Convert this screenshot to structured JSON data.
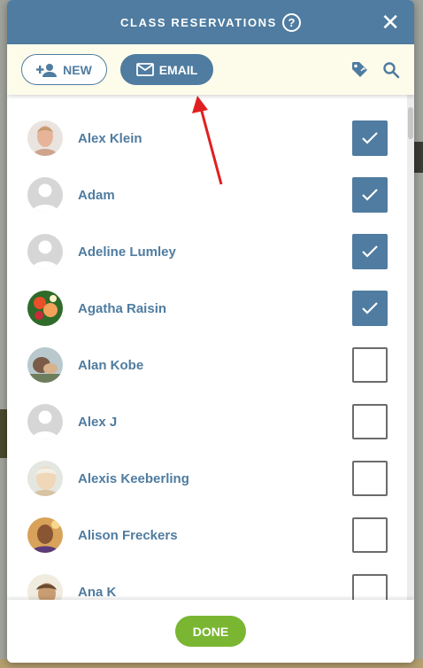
{
  "modal": {
    "title": "CLASS RESERVATIONS",
    "help_glyph": "?",
    "close_glyph": "✕"
  },
  "toolbar": {
    "new_label": "NEW",
    "email_label": "EMAIL",
    "icons": [
      "person-add-icon",
      "mail-icon",
      "tag-icon",
      "search-icon"
    ]
  },
  "reservations": [
    {
      "name": "Alex Klein",
      "checked": true
    },
    {
      "name": "Adam",
      "checked": true
    },
    {
      "name": "Adeline Lumley",
      "checked": true
    },
    {
      "name": "Agatha Raisin",
      "checked": true
    },
    {
      "name": "Alan Kobe",
      "checked": false
    },
    {
      "name": "Alex J",
      "checked": false
    },
    {
      "name": "Alexis Keeberling",
      "checked": false
    },
    {
      "name": "Alison Freckers",
      "checked": false
    },
    {
      "name": "Ana K",
      "checked": false
    }
  ],
  "footer": {
    "done_label": "DONE"
  },
  "colors": {
    "primary": "#4f7ca0",
    "done": "#7ab632",
    "toolbar_bg": "#fdfbea",
    "arrow": "#e02020"
  }
}
